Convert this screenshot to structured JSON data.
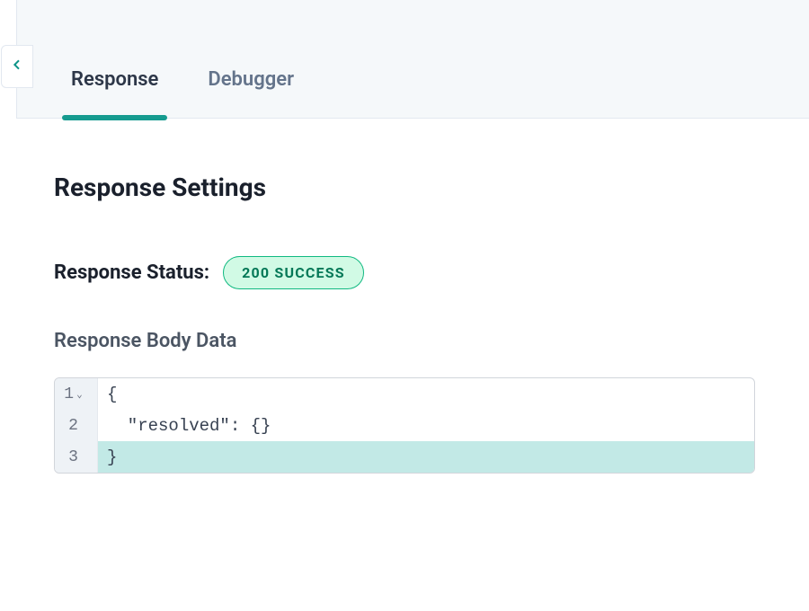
{
  "tabs": {
    "response": "Response",
    "debugger": "Debugger"
  },
  "heading": "Response Settings",
  "status": {
    "label": "Response Status:",
    "badge": "200 SUCCESS"
  },
  "body": {
    "label": "Response Body Data",
    "lines": [
      {
        "num": "1",
        "foldable": true,
        "text": "{",
        "highlighted": false
      },
      {
        "num": "2",
        "foldable": false,
        "text": "  \"resolved\": {}",
        "highlighted": false
      },
      {
        "num": "3",
        "foldable": false,
        "text": "}",
        "highlighted": true
      }
    ]
  }
}
